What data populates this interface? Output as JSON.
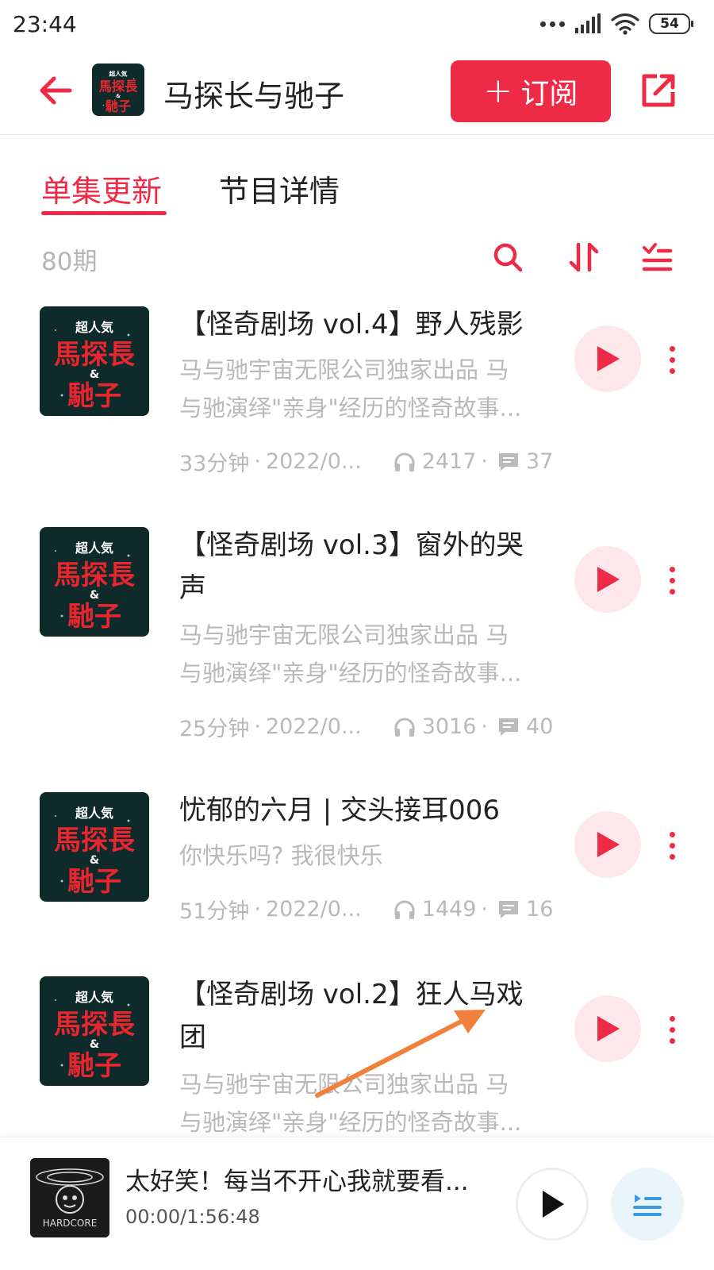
{
  "status_bar": {
    "time": "23:44",
    "battery": "54"
  },
  "header": {
    "title": "马探长与驰子",
    "subscribe_label": "订阅"
  },
  "tabs": [
    {
      "label": "单集更新"
    },
    {
      "label": "节目详情"
    }
  ],
  "list": {
    "count": "80期"
  },
  "cover_art": {
    "top": "超人気",
    "line1": "馬探長",
    "amp": "&",
    "line2": "馳子"
  },
  "episodes": [
    {
      "title": "【怪奇剧场 vol.4】野人残影",
      "desc_line1": "马与驰宇宙无限公司独家出品 马",
      "desc_line2": "与驰演绎\"亲身\"经历的怪奇故事...",
      "duration": "33分钟",
      "date": "2022/0...",
      "plays": "2417",
      "comments": "37"
    },
    {
      "title_line1": "【怪奇剧场 vol.3】窗外的哭",
      "title_line2": "声",
      "desc_line1": "马与驰宇宙无限公司独家出品 马",
      "desc_line2": "与驰演绎\"亲身\"经历的怪奇故事...",
      "duration": "25分钟",
      "date": "2022/0...",
      "plays": "3016",
      "comments": "40"
    },
    {
      "title": "忧郁的六月 | 交头接耳006",
      "desc_line1": "你快乐吗? 我很快乐",
      "duration": "51分钟",
      "date": "2022/0...",
      "plays": "1449",
      "comments": "16"
    },
    {
      "title_line1": "【怪奇剧场 vol.2】狂人马戏",
      "title_line2": "团",
      "desc_line1": "马与驰宇宙无限公司独家出品 马",
      "desc_line2": "与驰演绎\"亲身\"经历的怪奇故事..."
    }
  ],
  "mini_player": {
    "title": "太好笑！每当不开心我就要看...",
    "time": "00:00/1:56:48",
    "cover_text": "HARDCORE"
  },
  "colors": {
    "accent": "#ee2b47",
    "accent_light": "#fde7ea",
    "text": "#222222",
    "muted": "#b9b9b9",
    "annotation": "#f0803c"
  }
}
